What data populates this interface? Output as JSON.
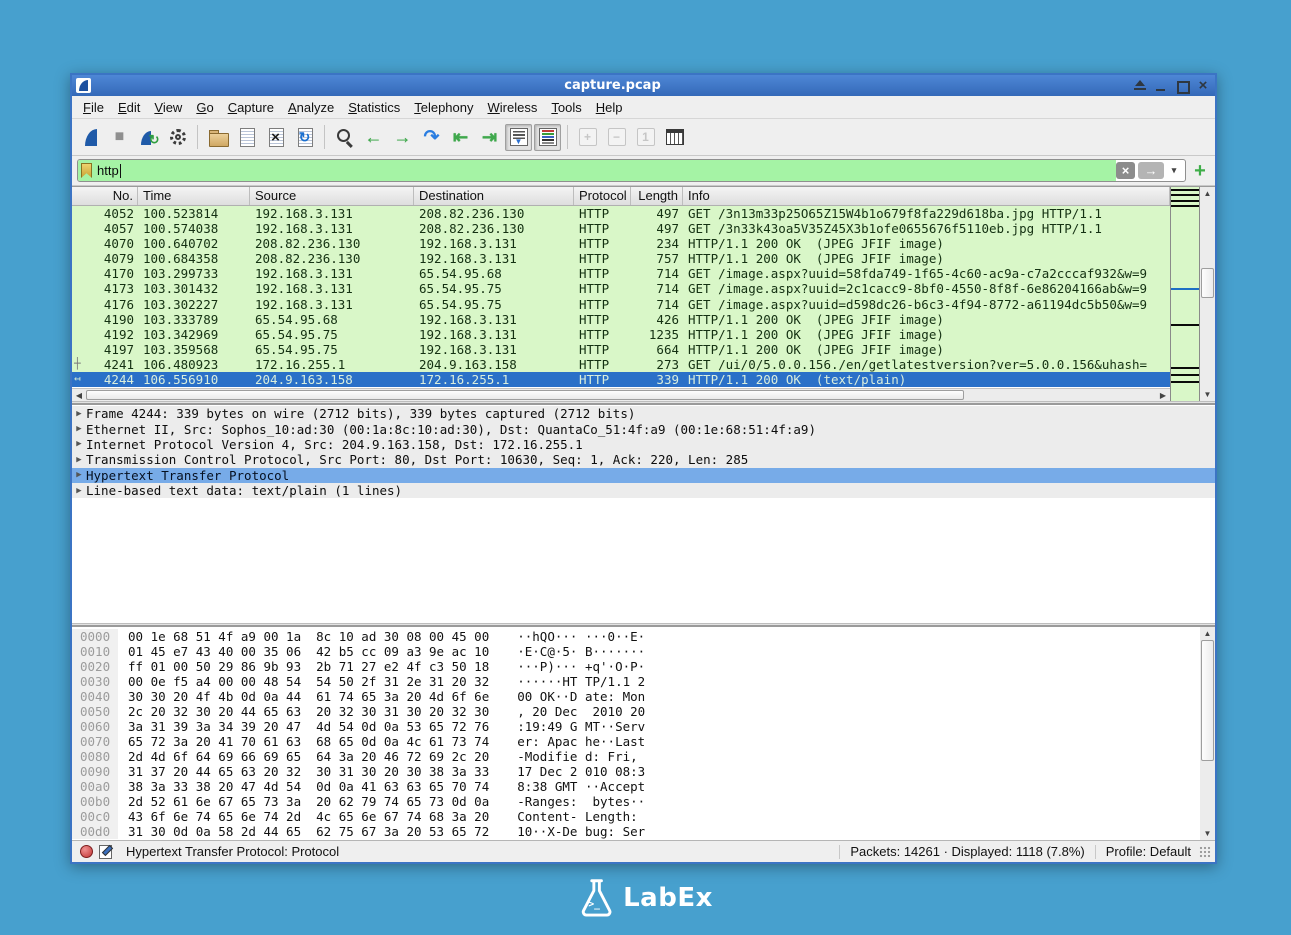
{
  "colors": {
    "desktop_bg": "#47a0ce",
    "titlebar_blue": "#3b74c4",
    "filter_green": "#a5f3a5",
    "http_row_green": "#d9f7c8",
    "selection_blue": "#2a70c8",
    "details_selection_blue": "#77abe8",
    "arrow_green": "#3fa84c"
  },
  "window": {
    "title": "capture.pcap",
    "controls": [
      "shade",
      "minimize",
      "maximize",
      "close"
    ]
  },
  "menu": {
    "items": [
      {
        "label": "File",
        "underline": 0
      },
      {
        "label": "Edit",
        "underline": 0
      },
      {
        "label": "View",
        "underline": 0
      },
      {
        "label": "Go",
        "underline": 0
      },
      {
        "label": "Capture",
        "underline": 0
      },
      {
        "label": "Analyze",
        "underline": 0
      },
      {
        "label": "Statistics",
        "underline": 0
      },
      {
        "label": "Telephony",
        "underline": 0
      },
      {
        "label": "Wireless",
        "underline": 0
      },
      {
        "label": "Tools",
        "underline": 0
      },
      {
        "label": "Help",
        "underline": 0
      }
    ]
  },
  "toolbar": {
    "items": [
      {
        "name": "start-capture-icon",
        "kind": "fin"
      },
      {
        "name": "stop-capture-icon",
        "kind": "stop",
        "glyph": "■"
      },
      {
        "name": "restart-capture-icon",
        "kind": "fin-restart",
        "glyph": "↻"
      },
      {
        "name": "capture-options-icon",
        "kind": "gear"
      },
      {
        "sep": true
      },
      {
        "name": "open-file-icon",
        "kind": "folder"
      },
      {
        "name": "save-file-icon",
        "kind": "doc"
      },
      {
        "name": "close-file-icon",
        "kind": "doc doc-close",
        "glyph": "×"
      },
      {
        "name": "reload-file-icon",
        "kind": "doc doc-reload",
        "glyph": "↻"
      },
      {
        "sep": true
      },
      {
        "name": "find-packet-icon",
        "kind": "find"
      },
      {
        "name": "go-back-icon",
        "kind": "garrow",
        "glyph": "←"
      },
      {
        "name": "go-forward-icon",
        "kind": "garrow",
        "glyph": "→"
      },
      {
        "name": "go-to-packet-icon",
        "kind": "goto",
        "glyph": "↷"
      },
      {
        "name": "go-first-packet-icon",
        "kind": "garrow",
        "glyph": "⇤"
      },
      {
        "name": "go-last-packet-icon",
        "kind": "garrow",
        "glyph": "⇥"
      },
      {
        "name": "auto-scroll-icon",
        "kind": "liststripes autoscroll",
        "glyph": "▼",
        "pressed": true
      },
      {
        "name": "colorize-packets-icon",
        "kind": "liststripes colorize",
        "pressed": true
      },
      {
        "sep": true
      },
      {
        "name": "zoom-in-icon",
        "kind": "zbtn",
        "glyph": "+",
        "disabled": true
      },
      {
        "name": "zoom-out-icon",
        "kind": "zbtn",
        "glyph": "−",
        "disabled": true
      },
      {
        "name": "zoom-100-icon",
        "kind": "zbtn",
        "glyph": "1",
        "disabled": true
      },
      {
        "name": "resize-columns-icon",
        "kind": "colsicon"
      }
    ]
  },
  "filter": {
    "value": "http",
    "clear_label": "×",
    "apply_label": "→",
    "dropdown_label": "▾",
    "add_label": "+"
  },
  "packet_list": {
    "columns": [
      {
        "key": "no",
        "label": "No."
      },
      {
        "key": "time",
        "label": "Time"
      },
      {
        "key": "source",
        "label": "Source"
      },
      {
        "key": "destination",
        "label": "Destination"
      },
      {
        "key": "protocol",
        "label": "Protocol"
      },
      {
        "key": "length",
        "label": "Length"
      },
      {
        "key": "info",
        "label": "Info"
      }
    ],
    "rows": [
      {
        "no": "4052",
        "time": "100.523814",
        "source": "192.168.3.131",
        "destination": "208.82.236.130",
        "protocol": "HTTP",
        "length": "497",
        "info": "GET /3n13m33p25O65Z15W4b1o679f8fa229d618ba.jpg HTTP/1.1"
      },
      {
        "no": "4057",
        "time": "100.574038",
        "source": "192.168.3.131",
        "destination": "208.82.236.130",
        "protocol": "HTTP",
        "length": "497",
        "info": "GET /3n33k43oa5V35Z45X3b1ofe0655676f5110eb.jpg HTTP/1.1"
      },
      {
        "no": "4070",
        "time": "100.640702",
        "source": "208.82.236.130",
        "destination": "192.168.3.131",
        "protocol": "HTTP",
        "length": "234",
        "info": "HTTP/1.1 200 OK  (JPEG JFIF image)"
      },
      {
        "no": "4079",
        "time": "100.684358",
        "source": "208.82.236.130",
        "destination": "192.168.3.131",
        "protocol": "HTTP",
        "length": "757",
        "info": "HTTP/1.1 200 OK  (JPEG JFIF image)"
      },
      {
        "no": "4170",
        "time": "103.299733",
        "source": "192.168.3.131",
        "destination": "65.54.95.68",
        "protocol": "HTTP",
        "length": "714",
        "info": "GET /image.aspx?uuid=58fda749-1f65-4c60-ac9a-c7a2cccaf932&w=9"
      },
      {
        "no": "4173",
        "time": "103.301432",
        "source": "192.168.3.131",
        "destination": "65.54.95.75",
        "protocol": "HTTP",
        "length": "714",
        "info": "GET /image.aspx?uuid=2c1cacc9-8bf0-4550-8f8f-6e86204166ab&w=9"
      },
      {
        "no": "4176",
        "time": "103.302227",
        "source": "192.168.3.131",
        "destination": "65.54.95.75",
        "protocol": "HTTP",
        "length": "714",
        "info": "GET /image.aspx?uuid=d598dc26-b6c3-4f94-8772-a61194dc5b50&w=9"
      },
      {
        "no": "4190",
        "time": "103.333789",
        "source": "65.54.95.68",
        "destination": "192.168.3.131",
        "protocol": "HTTP",
        "length": "426",
        "info": "HTTP/1.1 200 OK  (JPEG JFIF image)"
      },
      {
        "no": "4192",
        "time": "103.342969",
        "source": "65.54.95.75",
        "destination": "192.168.3.131",
        "protocol": "HTTP",
        "length": "1235",
        "info": "HTTP/1.1 200 OK  (JPEG JFIF image)"
      },
      {
        "no": "4197",
        "time": "103.359568",
        "source": "65.54.95.75",
        "destination": "192.168.3.131",
        "protocol": "HTTP",
        "length": "664",
        "info": "HTTP/1.1 200 OK  (JPEG JFIF image)"
      },
      {
        "no": "4241",
        "time": "106.480923",
        "source": "172.16.255.1",
        "destination": "204.9.163.158",
        "protocol": "HTTP",
        "length": "273",
        "info": "GET /ui/0/5.0.0.156./en/getlatestversion?ver=5.0.0.156&uhash=",
        "marker": "┼"
      },
      {
        "no": "4244",
        "time": "106.556910",
        "source": "204.9.163.158",
        "destination": "172.16.255.1",
        "protocol": "HTTP",
        "length": "339",
        "info": "HTTP/1.1 200 OK  (text/plain)",
        "selected": true,
        "marker": "↤"
      }
    ],
    "minimap": {
      "lines": [
        {
          "pos": 0.01,
          "color": "#0a0a0a"
        },
        {
          "pos": 0.035,
          "color": "#0a0a0a"
        },
        {
          "pos": 0.06,
          "color": "#0a0a0a"
        },
        {
          "pos": 0.085,
          "color": "#0a0a0a"
        },
        {
          "pos": 0.47,
          "color": "#1f6fc4"
        },
        {
          "pos": 0.64,
          "color": "#0a0a0a"
        },
        {
          "pos": 0.84,
          "color": "#0a0a0a"
        },
        {
          "pos": 0.875,
          "color": "#0a0a0a"
        },
        {
          "pos": 0.905,
          "color": "#0a0a0a"
        }
      ]
    }
  },
  "details": {
    "expander": "▶",
    "rows": [
      {
        "text": "Frame 4244: 339 bytes on wire (2712 bits), 339 bytes captured (2712 bits)"
      },
      {
        "text": "Ethernet II, Src: Sophos_10:ad:30 (00:1a:8c:10:ad:30), Dst: QuantaCo_51:4f:a9 (00:1e:68:51:4f:a9)"
      },
      {
        "text": "Internet Protocol Version 4, Src: 204.9.163.158, Dst: 172.16.255.1"
      },
      {
        "text": "Transmission Control Protocol, Src Port: 80, Dst Port: 10630, Seq: 1, Ack: 220, Len: 285"
      },
      {
        "text": "Hypertext Transfer Protocol",
        "selected": true
      },
      {
        "text": "Line-based text data: text/plain (1 lines)"
      }
    ]
  },
  "hex": {
    "rows": [
      {
        "offset": "0000",
        "hex1": "00 1e 68 51 4f a9 00 1a",
        "hex2": "8c 10 ad 30 08 00 45 00",
        "ascii1": "··hQO···",
        "ascii2": "···0··E·"
      },
      {
        "offset": "0010",
        "hex1": "01 45 e7 43 40 00 35 06",
        "hex2": "42 b5 cc 09 a3 9e ac 10",
        "ascii1": "·E·C@·5·",
        "ascii2": "B·······"
      },
      {
        "offset": "0020",
        "hex1": "ff 01 00 50 29 86 9b 93",
        "hex2": "2b 71 27 e2 4f c3 50 18",
        "ascii1": "···P)···",
        "ascii2": "+q'·O·P·"
      },
      {
        "offset": "0030",
        "hex1": "00 0e f5 a4 00 00 48 54",
        "hex2": "54 50 2f 31 2e 31 20 32",
        "ascii1": "······HT",
        "ascii2": "TP/1.1 2"
      },
      {
        "offset": "0040",
        "hex1": "30 30 20 4f 4b 0d 0a 44",
        "hex2": "61 74 65 3a 20 4d 6f 6e",
        "ascii1": "00 OK··D",
        "ascii2": "ate: Mon"
      },
      {
        "offset": "0050",
        "hex1": "2c 20 32 30 20 44 65 63",
        "hex2": "20 32 30 31 30 20 32 30",
        "ascii1": ", 20 Dec",
        "ascii2": " 2010 20"
      },
      {
        "offset": "0060",
        "hex1": "3a 31 39 3a 34 39 20 47",
        "hex2": "4d 54 0d 0a 53 65 72 76",
        "ascii1": ":19:49 G",
        "ascii2": "MT··Serv"
      },
      {
        "offset": "0070",
        "hex1": "65 72 3a 20 41 70 61 63",
        "hex2": "68 65 0d 0a 4c 61 73 74",
        "ascii1": "er: Apac",
        "ascii2": "he··Last"
      },
      {
        "offset": "0080",
        "hex1": "2d 4d 6f 64 69 66 69 65",
        "hex2": "64 3a 20 46 72 69 2c 20",
        "ascii1": "-Modifie",
        "ascii2": "d: Fri, "
      },
      {
        "offset": "0090",
        "hex1": "31 37 20 44 65 63 20 32",
        "hex2": "30 31 30 20 30 38 3a 33",
        "ascii1": "17 Dec 2",
        "ascii2": "010 08:3"
      },
      {
        "offset": "00a0",
        "hex1": "38 3a 33 38 20 47 4d 54",
        "hex2": "0d 0a 41 63 63 65 70 74",
        "ascii1": "8:38 GMT",
        "ascii2": "··Accept"
      },
      {
        "offset": "00b0",
        "hex1": "2d 52 61 6e 67 65 73 3a",
        "hex2": "20 62 79 74 65 73 0d 0a",
        "ascii1": "-Ranges:",
        "ascii2": " bytes··"
      },
      {
        "offset": "00c0",
        "hex1": "43 6f 6e 74 65 6e 74 2d",
        "hex2": "4c 65 6e 67 74 68 3a 20",
        "ascii1": "Content-",
        "ascii2": "Length: "
      },
      {
        "offset": "00d0",
        "hex1": "31 30 0d 0a 58 2d 44 65",
        "hex2": "62 75 67 3a 20 53 65 72",
        "ascii1": "10··X-De",
        "ascii2": "bug: Ser"
      }
    ]
  },
  "status": {
    "left_text": "Hypertext Transfer Protocol: Protocol",
    "packets_text": "Packets: 14261 · Displayed: 1118 (7.8%)",
    "profile_text": "Profile: Default"
  },
  "logo": {
    "text": "LabEx"
  }
}
